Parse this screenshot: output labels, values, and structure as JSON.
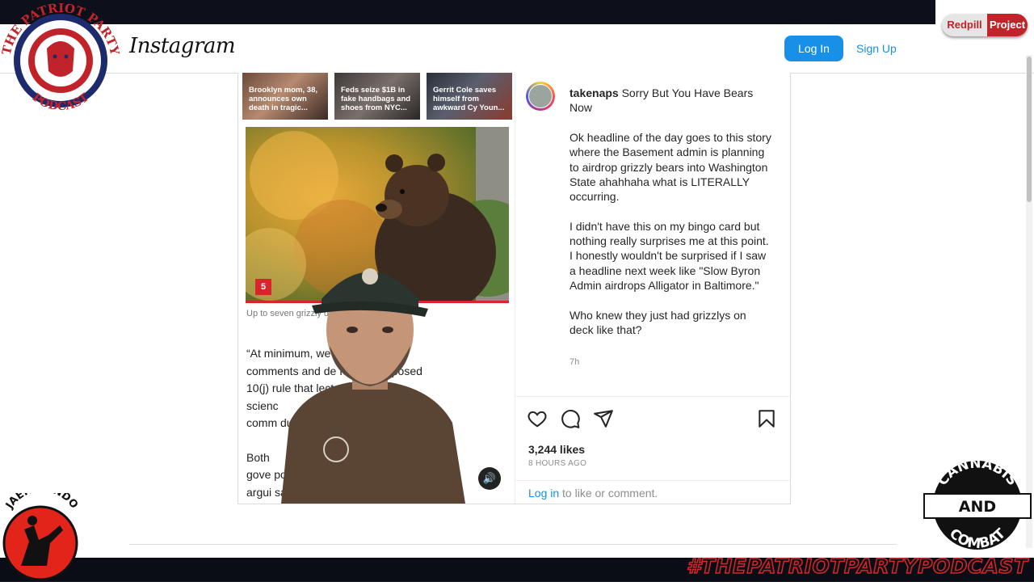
{
  "app": {
    "name": "Instagram"
  },
  "header": {
    "login_label": "Log In",
    "signup_label": "Sign Up"
  },
  "post": {
    "thumbnails": [
      {
        "text": "Brooklyn mom, 38, announces own death in tragic..."
      },
      {
        "text": "Feds seize $1B in fake handbags and shoes from NYC..."
      },
      {
        "text": "Gerrit Cole saves himself from awkward Cy Youn..."
      }
    ],
    "slide_badge": "5",
    "photo_caption": "Up to seven grizzly  d annually in the plan.",
    "article_lines": [
      "“At minimum, we   ill consider our",
      "comments and de   IS and proposed",
      "10(j) rule that   lects the current",
      "scienc",
      "comm   duction.”",
      "",
      "Both",
      "gove   pos",
      "argui   sal would"
    ],
    "username": "takenaps",
    "title_text": "Sorry But You Have Bears Now",
    "caption": "Ok headline of the day goes to this story where the Basement admin is planning to airdrop grizzly bears into Washington State ahahhaha what is LITERALLY occurring.\n\nI didn't have this on my bingo card but nothing really surprises me at this point. I honestly wouldn't be surprised if I saw a headline next week like \"Slow Byron Admin airdrops Alligator in Baltimore.\"\n\nWho knew they just had grizzlys on deck like that?",
    "time": "7h",
    "likes": "3,244 likes",
    "posted_ago": "8 HOURS AGO",
    "comment_login": "Log in",
    "comment_suffix": " to like or comment."
  },
  "overlays": {
    "patriot_top": "THE PATRIOT PARTY",
    "patriot_bottom": "PODCAST",
    "redpill_left": "Redpill",
    "redpill_right": "Project",
    "jaek": "JAEKWONDO",
    "cannabis_top": "CANNABIS",
    "cannabis_mid": "AND",
    "cannabis_bottom": "COMBAT",
    "hashtag": "#THEPATRIOTPARTYPODCAST"
  },
  "colors": {
    "instagram_blue": "#1890e8",
    "brand_red": "#c0242a"
  },
  "icons": [
    "heart-icon",
    "comment-icon",
    "share-icon",
    "bookmark-icon",
    "sound-icon"
  ]
}
